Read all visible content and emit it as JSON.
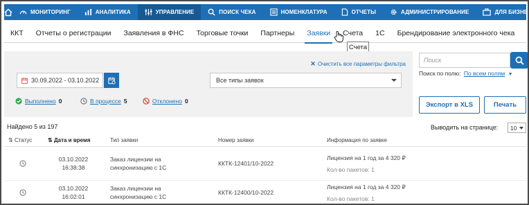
{
  "topnav": {
    "home_icon": "home-icon",
    "items": [
      {
        "label": "МОНИТОРИНГ",
        "icon": "gauge-icon"
      },
      {
        "label": "АНАЛИТИКА",
        "icon": "bar-chart-icon"
      },
      {
        "label": "УПРАВЛЕНИЕ",
        "icon": "sliders-icon"
      },
      {
        "label": "ПОИСК ЧЕКА",
        "icon": "search-icon"
      },
      {
        "label": "НОМЕНКЛАТУРА",
        "icon": "list-icon"
      },
      {
        "label": "ОТЧЕТЫ",
        "icon": "document-icon"
      },
      {
        "label": "АДМИНИСТРИРОВАНИЕ",
        "icon": "gear-icon"
      },
      {
        "label": "ДЛЯ БИЗНЕСА",
        "icon": "briefcase-icon"
      }
    ],
    "active_index": 2
  },
  "subnav": {
    "items": [
      "ККТ",
      "Отчеты о регистрации",
      "Заявления в ФНС",
      "Торговые точки",
      "Партнеры",
      "Заявки",
      "Счета",
      "1С",
      "Брендирование электронного чека"
    ],
    "active_index": 5
  },
  "tooltip": {
    "text": "Счета"
  },
  "filters": {
    "clear_label": "Очистить все параметры фильтра",
    "date_range": "30.09.2022 - 03.10.2022",
    "type_select": "Все типы заявок",
    "statuses": [
      {
        "label": "Выполнено",
        "count": "0"
      },
      {
        "label": "В процессе",
        "count": "5"
      },
      {
        "label": "Отклонено",
        "count": "0"
      }
    ]
  },
  "search": {
    "placeholder": "Поиск",
    "field_prefix": "Поиск по полю:",
    "field_value": "По всем полям"
  },
  "actions": {
    "export_label": "Экспорт в XLS",
    "print_label": "Печать"
  },
  "results": {
    "found_text": "Найдено 5 из 197",
    "per_page_label": "Выводить на странице:",
    "per_page_value": "10"
  },
  "table": {
    "headers": {
      "status": "Статус",
      "date": "Дата и время",
      "type": "Тип заявки",
      "number": "Номер заявки",
      "info": "Информация по заявке"
    },
    "rows": [
      {
        "date": "03.10.2022",
        "time": "16:38:38",
        "type_line1": "Заказ лицензии на",
        "type_line2": "синхронизацию с 1С",
        "number": "ККТК-12401/10-2022",
        "info_line1": "Лицензия на 1 год за 4 320 ₽",
        "info_line2": "Кол-во пакетов: 1"
      },
      {
        "date": "03.10.2022",
        "time": "16:02:01",
        "type_line1": "Заказ лицензии на",
        "type_line2": "синхронизацию с 1С",
        "number": "ККТК-12400/10-2022",
        "info_line1": "Лицензия на 1 год за 4 320 ₽",
        "info_line2": "Кол-во пакетов: 1"
      }
    ]
  },
  "colors": {
    "primary": "#1e6fb6",
    "nav_active": "#165a94",
    "success": "#2eae4f",
    "danger": "#d9443a"
  }
}
